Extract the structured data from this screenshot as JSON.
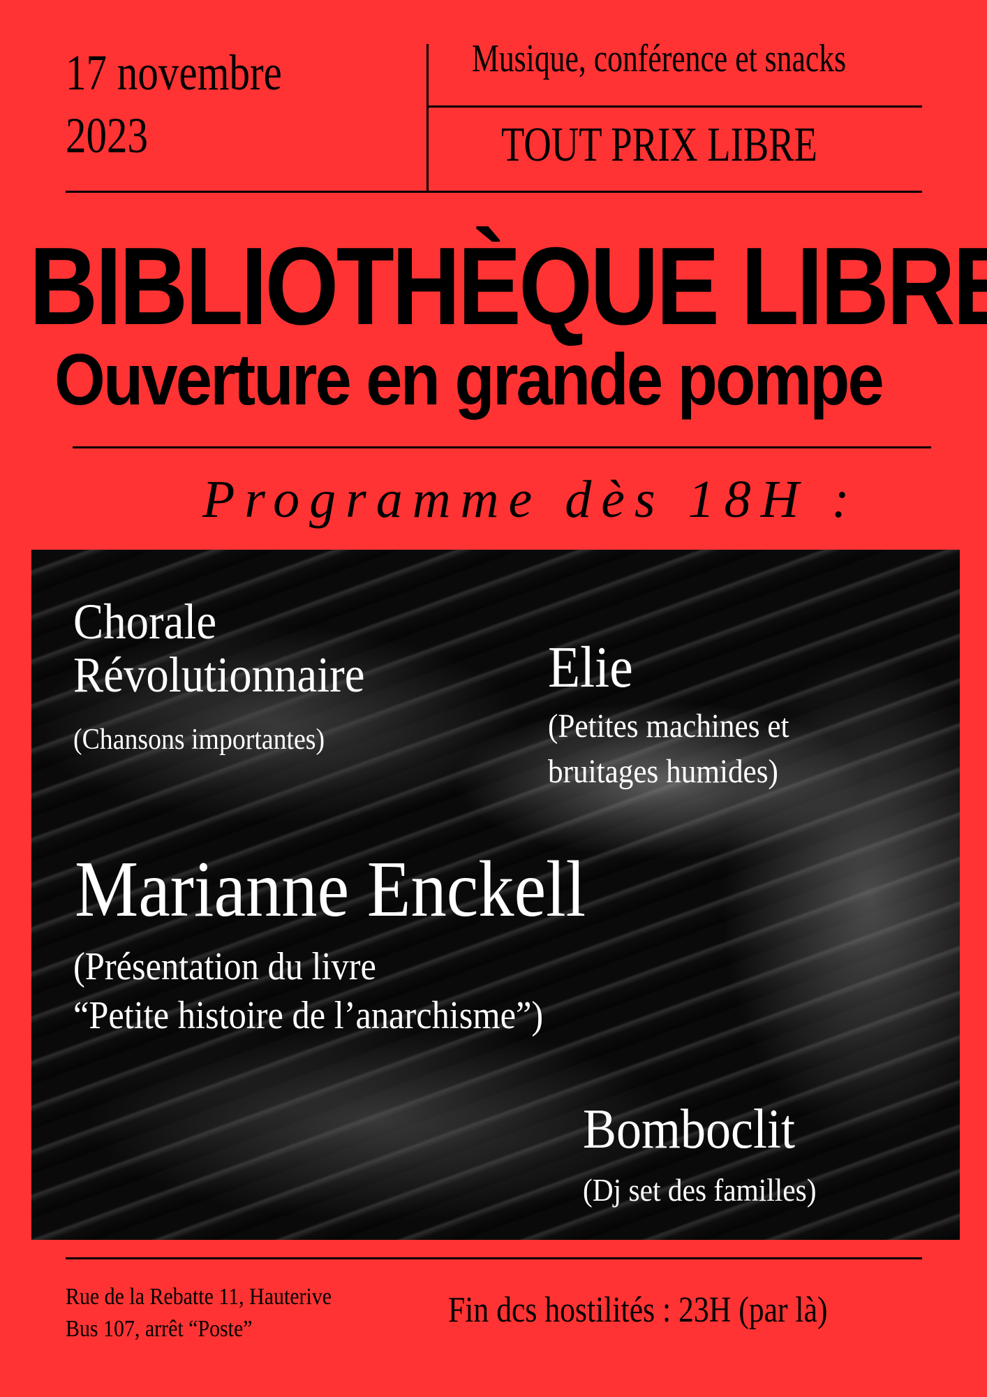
{
  "header": {
    "date_line1": "17 novembre",
    "date_line2": "2023",
    "tagline": "Musique, conférence et snacks",
    "price": "TOUT PRIX LIBRE"
  },
  "title": "BIBLIOTHÈQUE LIBRE",
  "subtitle": "Ouverture en grande pompe",
  "programme_heading": "Programme dès 18H :",
  "programme": [
    {
      "name_line1": "Chorale",
      "name_line2": "Révolutionnaire",
      "desc_line1": "(Chansons importantes)"
    },
    {
      "name_line1": "Elie",
      "desc_line1": "(Petites machines et",
      "desc_line2": "bruitages humides)"
    },
    {
      "name_line1": "Marianne Enckell",
      "desc_line1": "(Présentation du livre",
      "desc_line2": "“Petite histoire de l’anarchisme”)"
    },
    {
      "name_line1": "Bomboclit",
      "desc_line1": "(Dj set des familles)"
    }
  ],
  "footer": {
    "address_line1": "Rue de la Rebatte 11, Hauterive",
    "address_line2": "Bus 107, arrêt “Poste”",
    "end_time": "Fin dcs hostilités : 23H (par là)"
  },
  "colors": {
    "background": "#ff3333",
    "text": "#000000",
    "box": "#000000",
    "box_text": "#ffffff"
  }
}
